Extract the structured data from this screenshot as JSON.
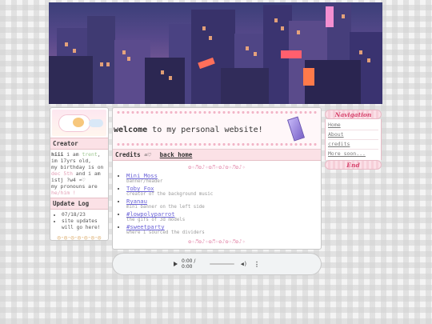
{
  "banner": {
    "alt": "pixel art city at night banner"
  },
  "left": {
    "creator_header": "Creator",
    "intro_prefix": "hiii",
    "intro_text1": " i am ",
    "name": "trent",
    "intro_text2": ",",
    "age": "im 17yrs old,",
    "bday_prefix": "my birthday is on ",
    "bday": "dec 5th",
    "bday_suffix": " and i am",
    "ist": "istj ?w4 ",
    "pronouns_prefix": "my pronouns are ",
    "pronouns": "he/him !",
    "update_header": "Update Log",
    "updates": [
      "07/18/23",
      "site updates will go here!"
    ],
    "deco": "◎-◎-◎-◎-◎-◎-◎"
  },
  "main": {
    "welcome_bold": "welcome",
    "welcome_rest": " to my personal website!",
    "credits_label": "Credits ",
    "credits_hearts": "♒♡",
    "back_home": "back home",
    "divider": "✿✧♬✿♪✧✿♬✧✿♪✿✧♬✿♪✧",
    "credits": [
      {
        "name": "Mini Moss",
        "desc": "banner/header"
      },
      {
        "name": "Toby Fox",
        "desc": "creator of the background music"
      },
      {
        "name": "Ryanau",
        "desc": "mini banner on the left side"
      },
      {
        "name": "#lowpolyparrot",
        "desc": "the gifs of 3d models"
      },
      {
        "name": "#sweetparty",
        "desc": "where i sourced the dividers"
      }
    ]
  },
  "audio": {
    "time": "0:00 / 0:00",
    "volume_icon": "speaker-icon",
    "more_icon": "more-icon"
  },
  "nav": {
    "header": "Navigation",
    "items": [
      "Home",
      "About",
      "credits",
      "More soon..."
    ],
    "footer": "End"
  }
}
